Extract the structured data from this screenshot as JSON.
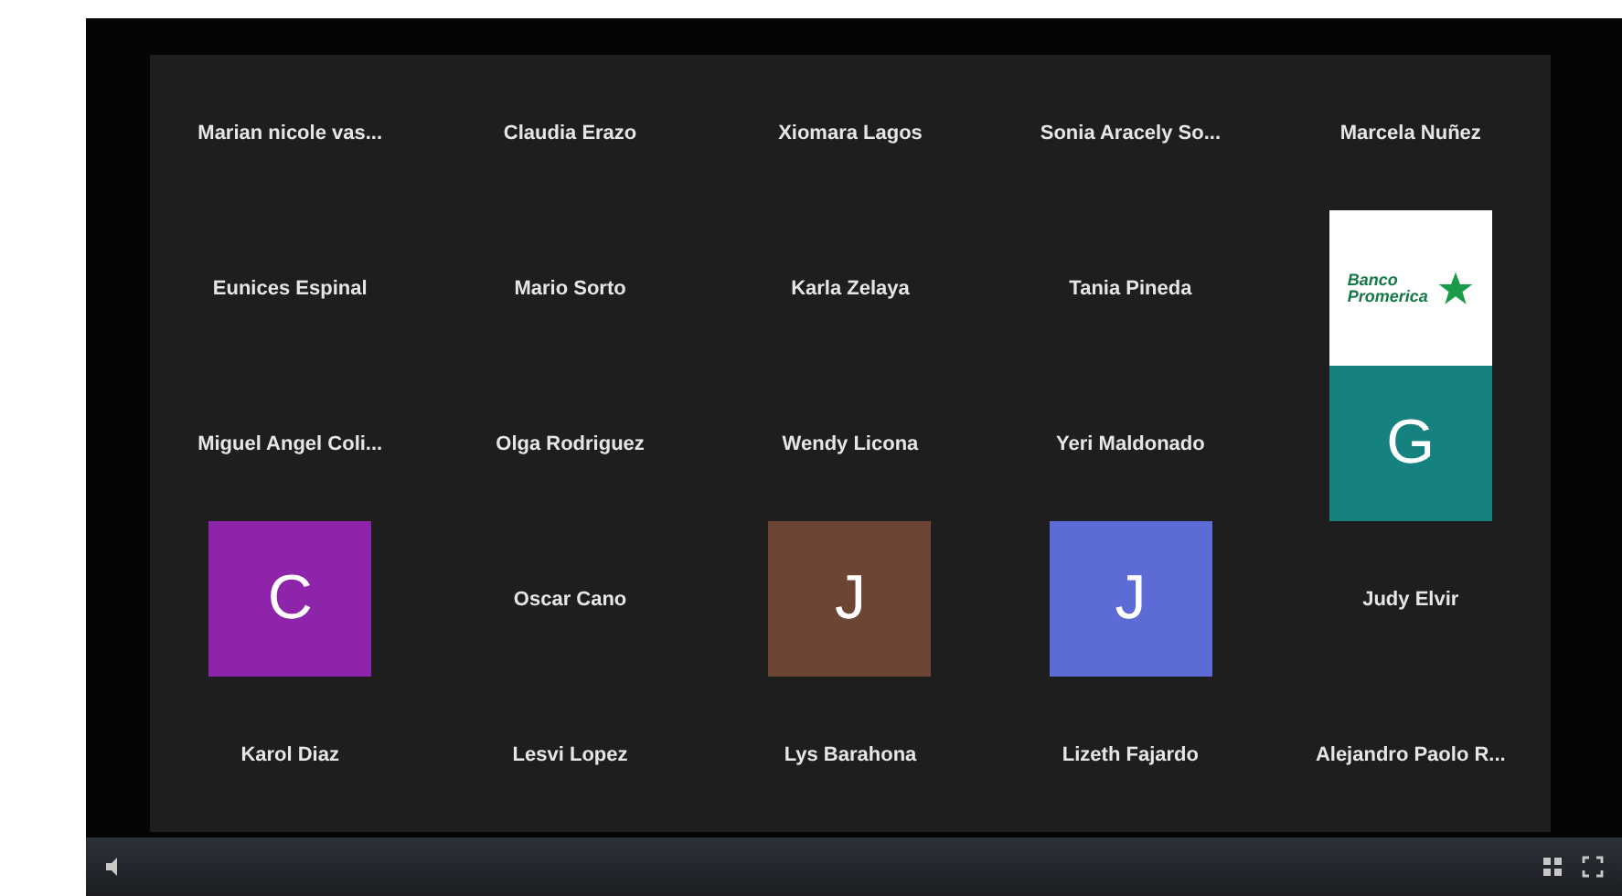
{
  "tiles": [
    {
      "kind": "name",
      "name": "Marian nicole vas..."
    },
    {
      "kind": "name",
      "name": "Claudia Erazo"
    },
    {
      "kind": "name",
      "name": "Xiomara Lagos"
    },
    {
      "kind": "name",
      "name": "Sonia Aracely So..."
    },
    {
      "kind": "name",
      "name": "Marcela Nuñez"
    },
    {
      "kind": "name",
      "name": "Eunices Espinal"
    },
    {
      "kind": "name",
      "name": "Mario Sorto"
    },
    {
      "kind": "name",
      "name": "Karla Zelaya"
    },
    {
      "kind": "name",
      "name": "Tania Pineda"
    },
    {
      "kind": "logo",
      "logo_text": "Banco Promerica"
    },
    {
      "kind": "name",
      "name": "Miguel Angel Coli..."
    },
    {
      "kind": "name",
      "name": "Olga Rodriguez"
    },
    {
      "kind": "name",
      "name": "Wendy Licona"
    },
    {
      "kind": "name",
      "name": "Yeri Maldonado"
    },
    {
      "kind": "avatar",
      "letter": "G",
      "color": "#16827f"
    },
    {
      "kind": "avatar",
      "letter": "C",
      "color": "#8e24aa"
    },
    {
      "kind": "name",
      "name": "Oscar Cano"
    },
    {
      "kind": "avatar",
      "letter": "J",
      "color": "#6d4535"
    },
    {
      "kind": "avatar",
      "letter": "J",
      "color": "#5c6bd6"
    },
    {
      "kind": "name",
      "name": "Judy Elvir"
    },
    {
      "kind": "name",
      "name": "Karol Diaz"
    },
    {
      "kind": "name",
      "name": "Lesvi Lopez"
    },
    {
      "kind": "name",
      "name": "Lys Barahona"
    },
    {
      "kind": "name",
      "name": "Lizeth Fajardo"
    },
    {
      "kind": "name",
      "name": "Alejandro Paolo R..."
    }
  ]
}
